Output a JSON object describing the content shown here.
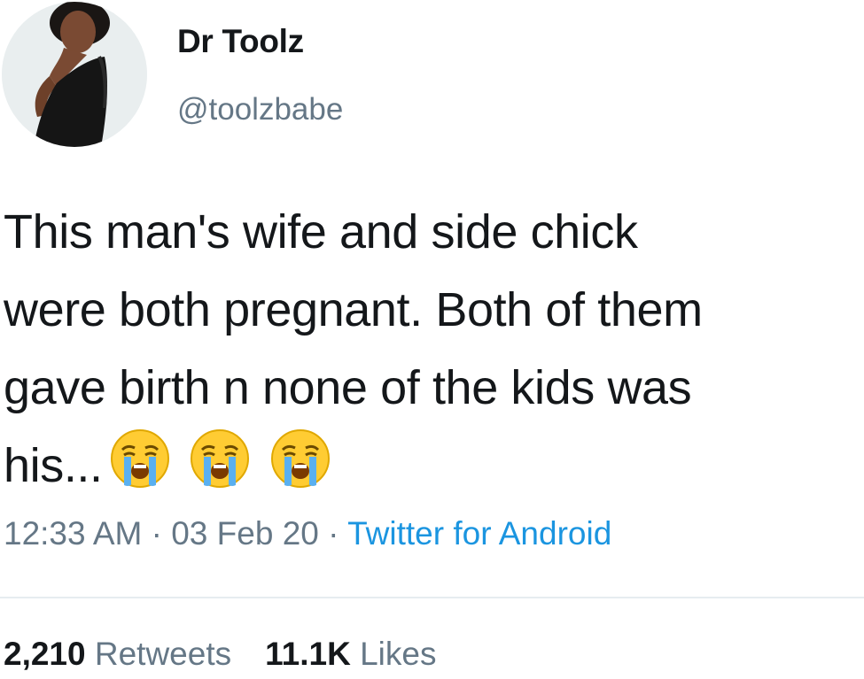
{
  "author": {
    "display_name": "Dr Toolz",
    "handle": "@toolzbabe",
    "avatar_icon": "profile-photo"
  },
  "tweet": {
    "lines": [
      "This man's wife and side chick",
      "were both pregnant. Both of them",
      "gave birth n none of the kids was",
      "his..."
    ],
    "emojis": [
      "loudly-crying-face-icon",
      "loudly-crying-face-icon",
      "loudly-crying-face-icon"
    ]
  },
  "meta": {
    "time": "12:33 AM",
    "sep1": " · ",
    "date": "03 Feb 20",
    "sep2": " · ",
    "source": "Twitter for Android"
  },
  "stats": {
    "retweets_count": "2,210",
    "retweets_label": "Retweets",
    "likes_count": "11.1K",
    "likes_label": "Likes"
  },
  "colors": {
    "text_primary": "#14171a",
    "text_secondary": "#657786",
    "link": "#1b95e0",
    "divider": "#e6ecf0"
  }
}
